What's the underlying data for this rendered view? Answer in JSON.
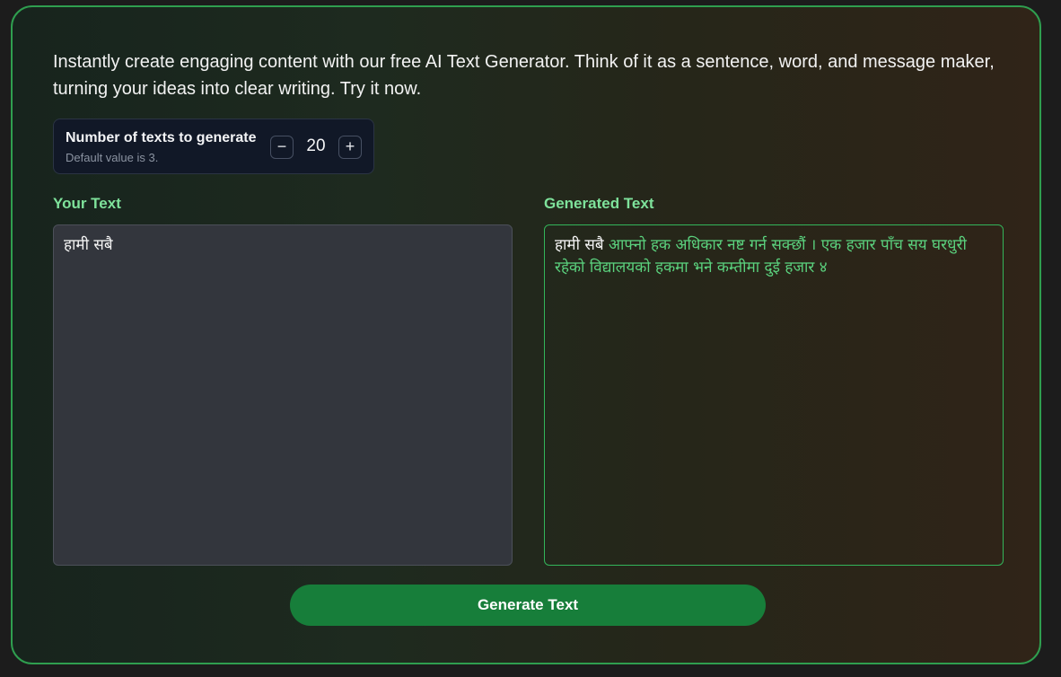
{
  "intro": {
    "text": "Instantly create engaging content with our free AI Text Generator. Think of it as a sentence, word, and message maker, turning your ideas into clear writing. Try it now."
  },
  "counter": {
    "label": "Number of texts to generate",
    "hint": "Default value is 3.",
    "value": "20",
    "minus_symbol": "−",
    "plus_symbol": "+"
  },
  "input": {
    "label": "Your Text",
    "value": "हामी सबै"
  },
  "output": {
    "label": "Generated Text",
    "prompt_echo": "हामी सबै",
    "generated": " आफ्नो हक अधिकार नष्ट गर्न सक्छौं । एक हजार पाँच सय घरधुरी रहेको विद्यालयको हकमा भने कम्तीमा दुई हजार ४"
  },
  "actions": {
    "generate_label": "Generate Text"
  },
  "colors": {
    "accent_green": "#177e3a",
    "label_green": "#7ee29b",
    "generated_green": "#5bd27e",
    "border_green": "#2f9e4f"
  }
}
